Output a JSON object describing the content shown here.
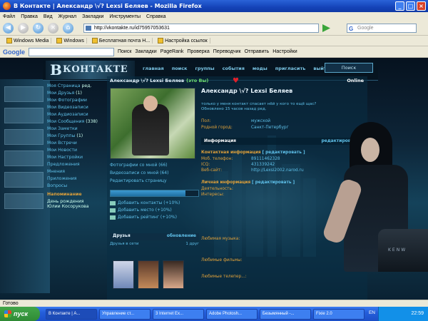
{
  "window": {
    "title": "В Контакте | Александр \\√? Lexsi Беляев - Mozilla Firefox"
  },
  "menu": [
    "Файл",
    "Правка",
    "Вид",
    "Журнал",
    "Закладки",
    "Инструменты",
    "Справка"
  ],
  "nav": {
    "url": "http://vkontakte.ru/id75957053631",
    "search_placeholder": "Google"
  },
  "bookmarks": [
    "Windows Media",
    "Windows",
    "Бесплатная почта H...",
    "Настройка ссылок"
  ],
  "google_toolbar": {
    "logo": "Google",
    "items": [
      "Поиск",
      "Закладки",
      "PageRank",
      "Проверка",
      "Переводчик",
      "Отправить",
      "Настройки"
    ]
  },
  "site": {
    "logo": "КОНТАКТЕ",
    "logo_initial": "В",
    "topnav": [
      "главная",
      "поиск",
      "группы",
      "события",
      "моды",
      "пригласить",
      "выйти"
    ],
    "search_button": "Поиск"
  },
  "sidebar": [
    {
      "label": "Моя Страница",
      "extra": "ред."
    },
    {
      "label": "Мои Друзья",
      "extra": "(1)"
    },
    {
      "label": "Мои Фотографии",
      "extra": ""
    },
    {
      "label": "Мои Видеозаписи",
      "extra": ""
    },
    {
      "label": "Мои Аудиозаписи",
      "extra": ""
    },
    {
      "label": "Мои Сообщения",
      "extra": "(338)"
    },
    {
      "label": "Мои Заметки",
      "extra": ""
    },
    {
      "label": "Мои Группы",
      "extra": "(1)"
    },
    {
      "label": "Мои Встречи",
      "extra": ""
    },
    {
      "label": "Мои Новости",
      "extra": ""
    },
    {
      "label": "Мои Настройки",
      "extra": ""
    },
    {
      "label": "Предложения",
      "extra": ""
    },
    {
      "label": "Мнения",
      "extra": ""
    },
    {
      "label": "Приложения",
      "extra": ""
    },
    {
      "label": "Вопросы",
      "extra": ""
    }
  ],
  "sidebar_ad": {
    "title": "Напоминание",
    "text": "День рождения Юлии Косорукова"
  },
  "profile": {
    "header_name": "Александр \\√? Lexsi Беляев",
    "header_self": "(это Вы)",
    "online": "Online",
    "name": "Александр \\√? Lexsi Беляев",
    "status": "только у меня контакт спасает нёй у кого то ещё щас?",
    "status_updated": "Обновлено 15 часов назад ред.",
    "info_basic": [
      {
        "k": "Пол:",
        "v": "мужской"
      },
      {
        "k": "Родной город:",
        "v": "Санкт-Петербург"
      }
    ],
    "info_header": "Информация",
    "info_edit": "редактировать",
    "contact_header": "Контактная информация",
    "contact_edit": "[ редактировать ]",
    "contacts": [
      {
        "k": "Моб. телефон:",
        "v": "89111462328"
      },
      {
        "k": "ICQ:",
        "v": "431339242"
      },
      {
        "k": "Веб-сайт:",
        "v": "http://Lexsi2002.narod.ru"
      }
    ],
    "personal_header": "Личная информация",
    "personal_edit": "[ редактировать ]",
    "personal": [
      {
        "k": "Деятельность:",
        "v": ""
      },
      {
        "k": "Интересы:",
        "v": ""
      },
      {
        "k": "Любимая музыка:",
        "v": ""
      },
      {
        "k": "Любимые фильмы:",
        "v": ""
      },
      {
        "k": "Любимые телепер...:",
        "v": ""
      }
    ]
  },
  "left_links": [
    "Фотографии со мной (66)",
    "Видеозаписи со мной (64)",
    "Редактировать страницу"
  ],
  "rating_fill": 0.85,
  "add_links": [
    "Добавить контакты (+10%)",
    "Добавить место (+10%)",
    "Добавить рейтинг (+10%)"
  ],
  "friends": {
    "title": "Друзья",
    "edit": "обновление",
    "sub": "Друзья в сети",
    "count": "1 друг"
  },
  "status_text": "Готово",
  "taskbar": {
    "start": "пуск",
    "tasks": [
      "В Контакте | А...",
      "Управление ст...",
      "3 Internet Ex...",
      "Adobe Photosh...",
      "Безымянный -...",
      "Fixie 2.0"
    ],
    "lang": "EN",
    "time": "22:59"
  }
}
